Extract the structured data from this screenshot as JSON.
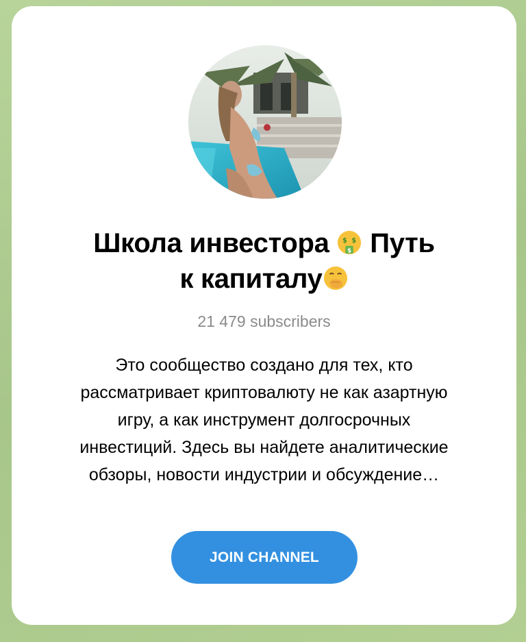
{
  "channel": {
    "title_line1": "Школа инвестора",
    "title_line1b": "Путь",
    "title_line2": "к капиталу",
    "title_emoji_1": "money-mouth-face-icon",
    "title_emoji_2": "face-with-hand-over-mouth-icon",
    "subscribers": "21 479 subscribers",
    "description_lines": [
      "Это сообщество создано для тех, кто",
      "рассматривает криптовалюту не как азартную",
      "игру, а как инструмент долгосрочных",
      "инвестиций. Здесь вы найдете аналитические",
      "обзоры, новости индустрии и обсуждение…"
    ],
    "join_label": "JOIN CHANNEL",
    "avatar_icon": "channel-avatar-photo"
  },
  "colors": {
    "background": "#a9c98a",
    "card": "#ffffff",
    "button": "#3390e0",
    "subscribers_text": "#8a8a8a"
  }
}
